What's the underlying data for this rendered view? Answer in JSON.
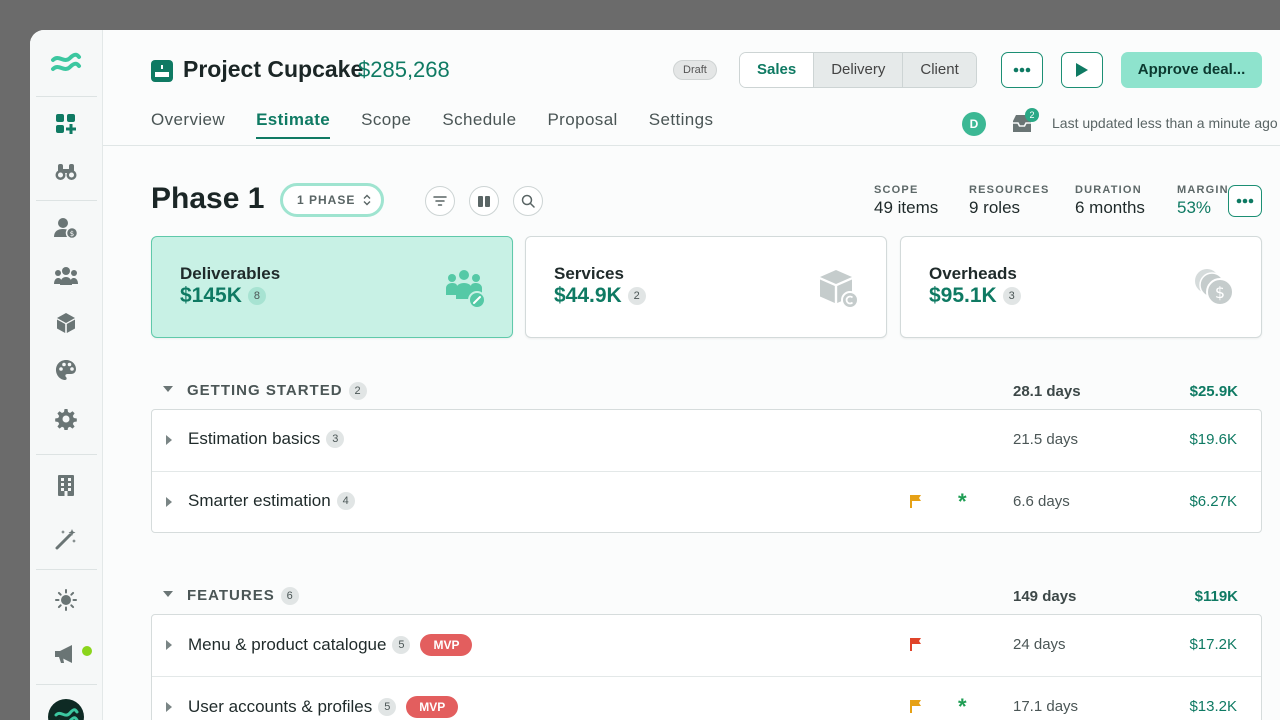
{
  "project": {
    "title": "Project Cupcake",
    "amount": "$285,268",
    "status": "Draft",
    "view_modes": [
      "Sales",
      "Delivery",
      "Client"
    ],
    "active_view": "Sales",
    "approve_label": "Approve deal..."
  },
  "tabs": [
    "Overview",
    "Estimate",
    "Scope",
    "Schedule",
    "Proposal",
    "Settings"
  ],
  "active_tab": "Estimate",
  "header_meta": {
    "user_initial": "D",
    "inbox_count": "2",
    "last_updated": "Last updated less than a minute ago"
  },
  "phase": {
    "title": "Phase 1",
    "selector_label": "1 PHASE",
    "stats": [
      {
        "label": "SCOPE",
        "value": "49 items"
      },
      {
        "label": "RESOURCES",
        "value": "9 roles"
      },
      {
        "label": "DURATION",
        "value": "6 months"
      },
      {
        "label": "MARGIN",
        "value": "53%"
      }
    ]
  },
  "cards": [
    {
      "title": "Deliverables",
      "amount": "$145K",
      "count": "8",
      "icon": "team-tools-icon"
    },
    {
      "title": "Services",
      "amount": "$44.9K",
      "count": "2",
      "icon": "box-clock-icon"
    },
    {
      "title": "Overheads",
      "amount": "$95.1K",
      "count": "3",
      "icon": "coins-dollar-icon"
    }
  ],
  "groups": [
    {
      "title": "GETTING STARTED",
      "count": "2",
      "days": "28.1 days",
      "amount": "$25.9K",
      "rows": [
        {
          "name": "Estimation basics",
          "count": "3",
          "days": "21.5 days",
          "amount": "$19.6K"
        },
        {
          "name": "Smarter estimation",
          "count": "4",
          "days": "6.6 days",
          "amount": "$6.27K",
          "flag": "yellow",
          "star": "*"
        }
      ]
    },
    {
      "title": "FEATURES",
      "count": "6",
      "days": "149 days",
      "amount": "$119K",
      "rows": [
        {
          "name": "Menu & product catalogue",
          "count": "5",
          "tag": "MVP",
          "days": "24 days",
          "amount": "$17.2K",
          "flag": "red"
        },
        {
          "name": "User accounts & profiles",
          "count": "5",
          "tag": "MVP",
          "days": "17.1 days",
          "amount": "$13.2K",
          "flag": "yellow",
          "star": "*"
        }
      ]
    }
  ],
  "colors": {
    "brand": "#0f7a63",
    "accent_light": "#8ee3cd",
    "card_active_bg": "#c8f1e5",
    "mvp": "#e35e5e",
    "flag_yellow": "#e6a116",
    "flag_red": "#e0442a",
    "star_green": "#1f9e54"
  }
}
